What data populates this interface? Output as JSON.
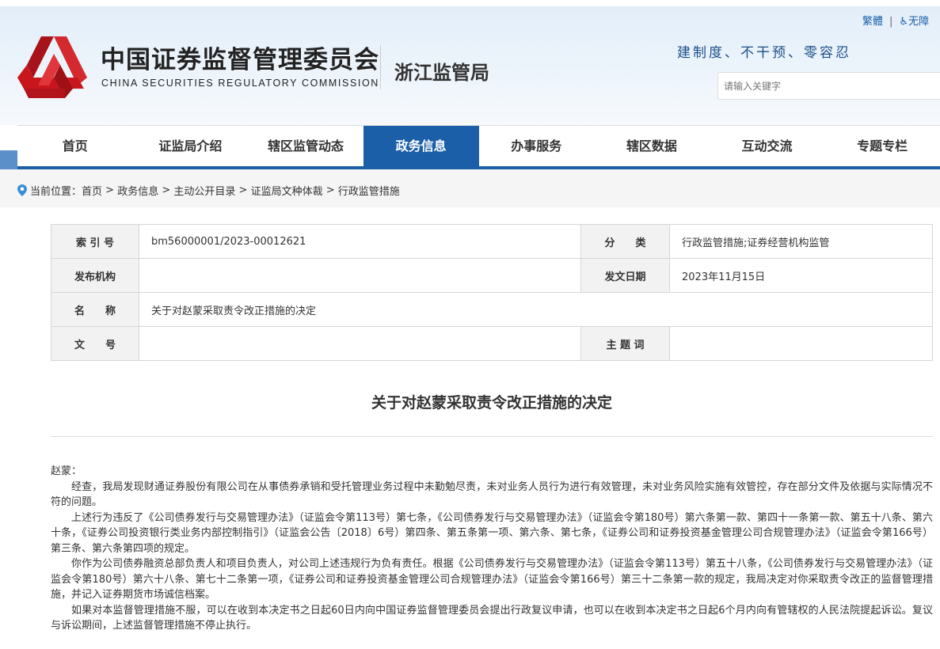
{
  "header": {
    "title_cn": "中国证券监督管理委员会",
    "title_en": "CHINA SECURITIES REGULATORY COMMISSION",
    "bureau": "浙江监管局",
    "slogan": "建制度、不干预、零容忍",
    "links": {
      "traditional": "繁體",
      "separator": "|",
      "accessibility": "无障"
    },
    "search_placeholder": "请输入关键字",
    "brand_color": "#c8161d"
  },
  "nav": {
    "items": [
      {
        "label": "首页"
      },
      {
        "label": "证监局介绍"
      },
      {
        "label": "辖区监管动态"
      },
      {
        "label": "政务信息",
        "active": true
      },
      {
        "label": "办事服务"
      },
      {
        "label": "辖区数据"
      },
      {
        "label": "互动交流"
      },
      {
        "label": "专题专栏"
      }
    ],
    "accent": "#1a5fa8"
  },
  "breadcrumb": {
    "prefix": "当前位置：",
    "items": [
      "首页",
      "政务信息",
      "主动公开目录",
      "证监局文种体裁",
      "行政监管措施"
    ],
    "sep": " > "
  },
  "meta": {
    "index_label": "索 引 号",
    "index_value": "bm56000001/2023-00012621",
    "category_label": "分　　类",
    "category_value": "行政监管措施;证券经营机构监管",
    "issuer_label": "发布机构",
    "issuer_value": "",
    "date_label": "发文日期",
    "date_value": "2023年11月15日",
    "name_label": "名　　称",
    "name_value": "关于对赵蒙采取责令改正措施的决定",
    "docno_label": "文　　号",
    "docno_value": "",
    "keywords_label": "主 题 词",
    "keywords_value": ""
  },
  "article": {
    "title": "关于对赵蒙采取责令改正措施的决定",
    "salutation": "赵蒙：",
    "paragraphs": [
      "经查，我局发现财通证券股份有限公司在从事债券承销和受托管理业务过程中未勤勉尽责，未对业务人员行为进行有效管理，未对业务风险实施有效管控，存在部分文件及依据与实际情况不符的问题。",
      "上述行为违反了《公司债券发行与交易管理办法》（证监会令第113号）第七条，《公司债券发行与交易管理办法》（证监会令第180号）第六条第一款、第四十一条第一款、第五十八条、第六十条，《证券公司投资银行类业务内部控制指引》（证监会公告〔2018〕6号）第四条、第五条第一项、第六条、第七条，《证券公司和证券投资基金管理公司合规管理办法》（证监会令第166号）第三条、第六条第四项的规定。",
      "你作为公司债券融资总部负责人和项目负责人，对公司上述违规行为负有责任。根据《公司债券发行与交易管理办法》（证监会令第113号）第五十八条，《公司债券发行与交易管理办法》（证监会令第180号）第六十八条、第七十二条第一项，《证券公司和证券投资基金管理公司合规管理办法》（证监会令第166号）第三十二条第一款的规定，我局决定对你采取责令改正的监督管理措施，并记入证券期货市场诚信档案。",
      "如果对本监督管理措施不服，可以在收到本决定书之日起60日内向中国证券监督管理委员会提出行政复议申请，也可以在收到本决定书之日起6个月内向有管辖权的人民法院提起诉讼。复议与诉讼期间，上述监督管理措施不停止执行。"
    ]
  }
}
